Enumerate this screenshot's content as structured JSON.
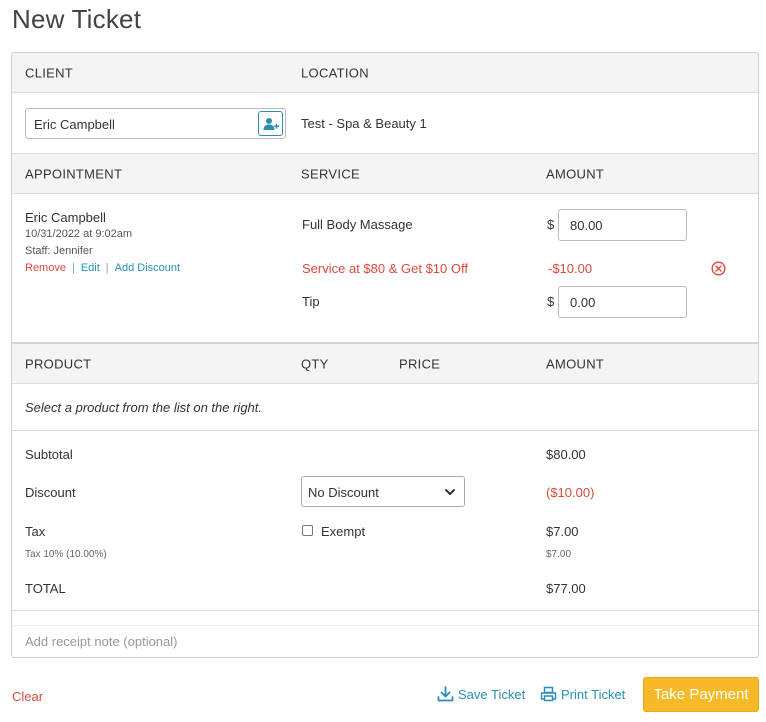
{
  "page_title": "New Ticket",
  "client_section": {
    "client_header": "CLIENT",
    "location_header": "LOCATION",
    "client_name": "Eric Campbell",
    "location_name": "Test - Spa & Beauty 1",
    "add_client_icon": "add-user-icon"
  },
  "appointment_section": {
    "appointment_header": "APPOINTMENT",
    "service_header": "SERVICE",
    "amount_header": "AMOUNT",
    "client_name": "Eric Campbell",
    "datetime": "10/31/2022 at 9:02am",
    "staff": "Staff: Jennifer",
    "remove_label": "Remove",
    "edit_label": "Edit",
    "add_discount_label": "Add Discount",
    "separator": "|",
    "service_name": "Full Body Massage",
    "currency_symbol": "$",
    "service_amount": "80.00",
    "discount_name": "Service at $80 & Get $10 Off",
    "discount_amount": "-$10.00",
    "remove_discount_icon": "close-circle-icon",
    "tip_label": "Tip",
    "tip_amount": "0.00"
  },
  "product_section": {
    "product_header": "PRODUCT",
    "qty_header": "QTY",
    "price_header": "PRICE",
    "amount_header": "AMOUNT",
    "empty_message": "Select a product from the list on the right."
  },
  "totals": {
    "subtotal_label": "Subtotal",
    "subtotal_value": "$80.00",
    "discount_label": "Discount",
    "discount_select_value": "No Discount",
    "discount_value": "($10.00)",
    "tax_label": "Tax",
    "exempt_label": "Exempt",
    "exempt_checked": false,
    "tax_value": "$7.00",
    "tax_detail_label": "Tax 10% (10.00%)",
    "tax_detail_value": "$7.00",
    "total_label": "TOTAL",
    "total_value": "$77.00"
  },
  "receipt_note_placeholder": "Add receipt note (optional)",
  "footer": {
    "clear_label": "Clear",
    "save_label": "Save Ticket",
    "print_label": "Print Ticket",
    "pay_label": "Take Payment"
  },
  "colors": {
    "accent": "#2a8fb5",
    "danger": "#d94a3a",
    "pay_button": "#f7b927"
  }
}
